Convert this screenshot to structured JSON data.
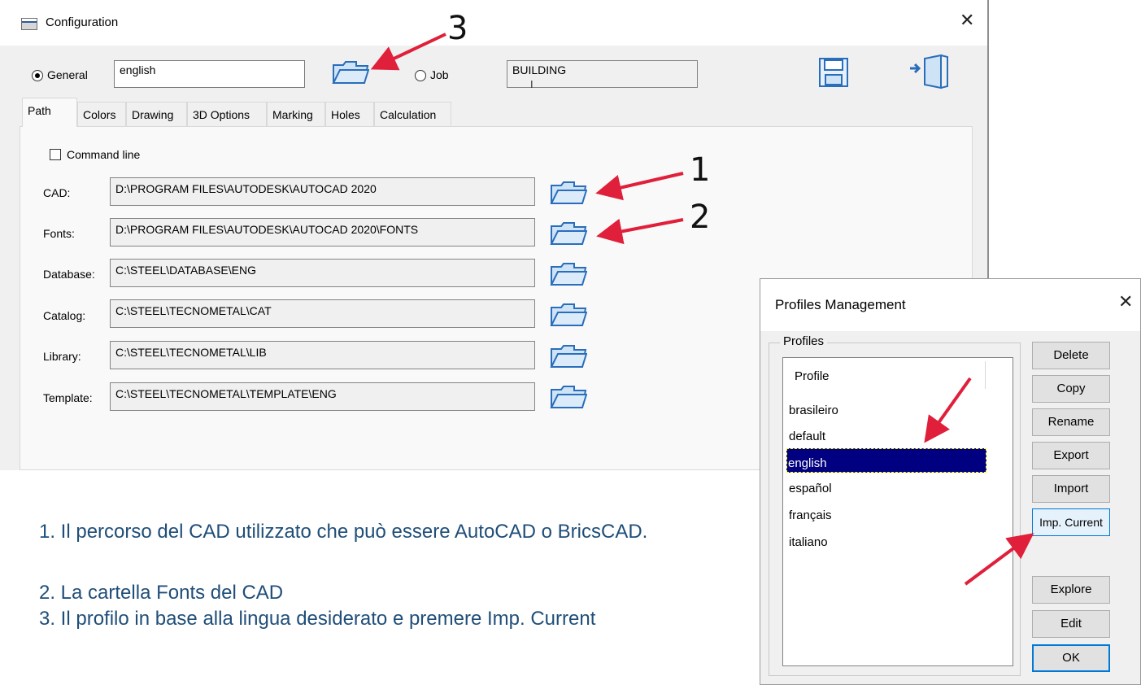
{
  "config": {
    "title": "Configuration",
    "scope": {
      "general_label": "General",
      "general_selected": true,
      "general_value": "english",
      "job_label": "Job",
      "job_selected": false,
      "job_value": "BUILDING"
    },
    "tabs": [
      "Path",
      "Colors",
      "Drawing",
      "3D Options",
      "Marking",
      "Holes",
      "Calculation"
    ],
    "active_tab": "Path",
    "command_line_label": "Command line",
    "command_line_checked": false,
    "paths": [
      {
        "label": "CAD:",
        "value": "D:\\PROGRAM FILES\\AUTODESK\\AUTOCAD 2020"
      },
      {
        "label": "Fonts:",
        "value": "D:\\PROGRAM FILES\\AUTODESK\\AUTOCAD 2020\\FONTS"
      },
      {
        "label": "Database:",
        "value": "C:\\STEEL\\DATABASE\\ENG"
      },
      {
        "label": "Catalog:",
        "value": "C:\\STEEL\\TECNOMETAL\\CAT"
      },
      {
        "label": "Library:",
        "value": "C:\\STEEL\\TECNOMETAL\\LIB"
      },
      {
        "label": "Template:",
        "value": "C:\\STEEL\\TECNOMETAL\\TEMPLATE\\ENG"
      }
    ],
    "icons": {
      "save": "save-icon",
      "exit": "exit-icon",
      "folder": "folder-open-icon",
      "close": "close-icon"
    }
  },
  "profiles": {
    "title": "Profiles Management",
    "group_label": "Profiles",
    "column_header": "Profile",
    "items": [
      "brasileiro",
      "default",
      "english",
      "español",
      "français",
      "italiano"
    ],
    "selected": "english",
    "buttons": {
      "delete": "Delete",
      "copy": "Copy",
      "rename": "Rename",
      "export": "Export",
      "import": "Import",
      "imp_current": "Imp. Current",
      "explore": "Explore",
      "edit": "Edit",
      "ok": "OK"
    }
  },
  "annotations": {
    "numbers": [
      "1",
      "2",
      "3"
    ],
    "arrow_color": "#e0203a"
  },
  "notes": [
    "1. Il percorso del CAD utilizzato che può essere AutoCAD o BricsCAD.",
    "2. La cartella Fonts del CAD",
    "3. Il profilo in base alla lingua desiderato e premere Imp. Current"
  ],
  "colors": {
    "note_text": "#1f4e79",
    "selection": "#000080",
    "focus_border": "#0078d7",
    "folder_fill": "#cfe3f6",
    "folder_stroke": "#2a6ebb"
  }
}
